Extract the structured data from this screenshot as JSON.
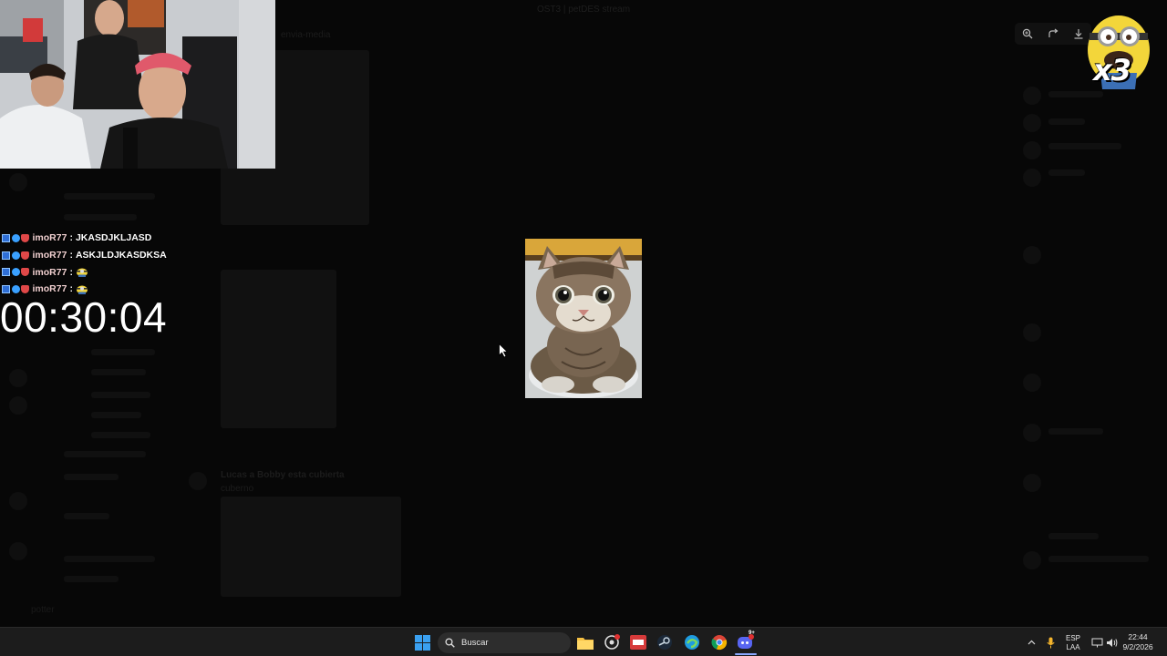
{
  "background_app": {
    "window_title": "OST3 | petDES stream",
    "channel_name": "envia-media",
    "message_author": "Lucas a Bobby esta cubierta",
    "message_text": "cuberno",
    "user_name": "potter"
  },
  "viewer_toolbar": {
    "zoom_icon": "zoom-in-icon",
    "rotate_icon": "rotate-icon",
    "download_icon": "download-icon"
  },
  "overlay": {
    "minion_multiplier": "x3",
    "timer": "00:30:04",
    "chat": [
      {
        "user": "imoR77",
        "text": "JKASDJKLJASD",
        "emote": false
      },
      {
        "user": "imoR77",
        "text": "ASKJLDJKASDKSA",
        "emote": false
      },
      {
        "user": "imoR77",
        "text": "",
        "emote": true
      },
      {
        "user": "imoR77",
        "text": "",
        "emote": true
      }
    ],
    "chat_separator": ":"
  },
  "taskbar": {
    "search_placeholder": "Buscar",
    "language_line1": "ESP",
    "language_line2": "LAA",
    "time": "22:44",
    "date": "9/2/2026",
    "discord_badge": "9+"
  },
  "colors": {
    "taskbar_bg": "#1c1c1c",
    "chat_user": "#f3d2d2",
    "discord": "#5865f2"
  }
}
